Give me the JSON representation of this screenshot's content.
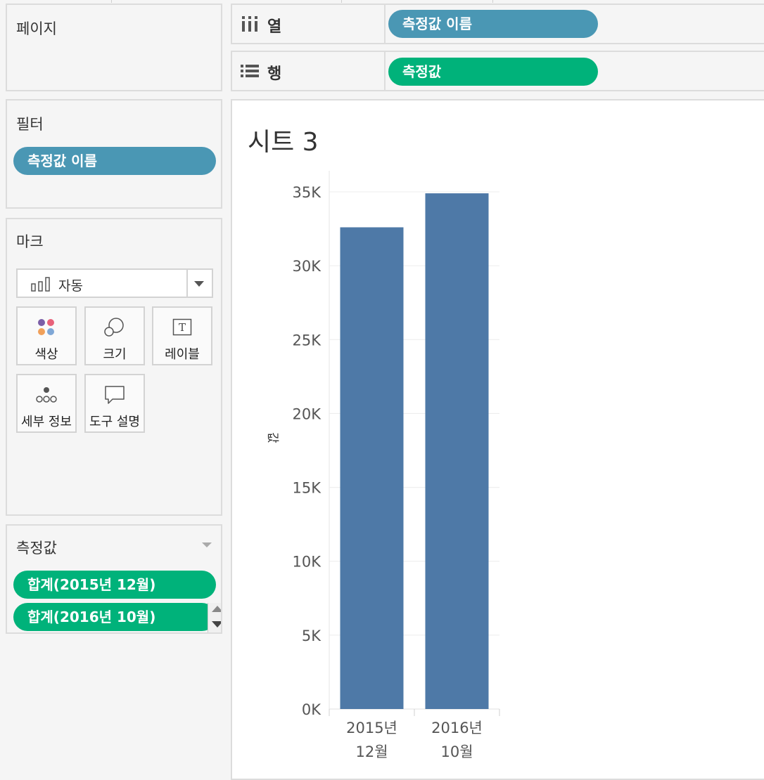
{
  "pages_panel": {
    "title": "페이지"
  },
  "filters_panel": {
    "title": "필터",
    "pills": [
      "측정값 이름"
    ]
  },
  "marks_panel": {
    "title": "마크",
    "mark_type": "자동",
    "buttons": [
      "색상",
      "크기",
      "레이블",
      "세부 정보",
      "도구 설명"
    ]
  },
  "measure_values_panel": {
    "title": "측정값",
    "pills": [
      "합계(2015년 12월)",
      "합계(2016년 10월)"
    ]
  },
  "columns_shelf": {
    "label": "열",
    "pill": "측정값 이름"
  },
  "rows_shelf": {
    "label": "행",
    "pill": "측정값"
  },
  "colors": {
    "measure_name_pill": "#4a97b4",
    "measure_pill": "#00b27a",
    "bar": "#4e79a7"
  },
  "chart_data": {
    "type": "bar",
    "title": "시트 3",
    "categories": [
      [
        "2015년",
        "12월"
      ],
      [
        "2016년",
        "10월"
      ]
    ],
    "values": [
      32600,
      34900
    ],
    "ylabel": "값",
    "ylim": [
      0,
      35000
    ],
    "y_ticks": [
      0,
      5000,
      10000,
      15000,
      20000,
      25000,
      30000,
      35000
    ],
    "y_tick_labels": [
      "0K",
      "5K",
      "10K",
      "15K",
      "20K",
      "25K",
      "30K",
      "35K"
    ],
    "grid": true
  }
}
